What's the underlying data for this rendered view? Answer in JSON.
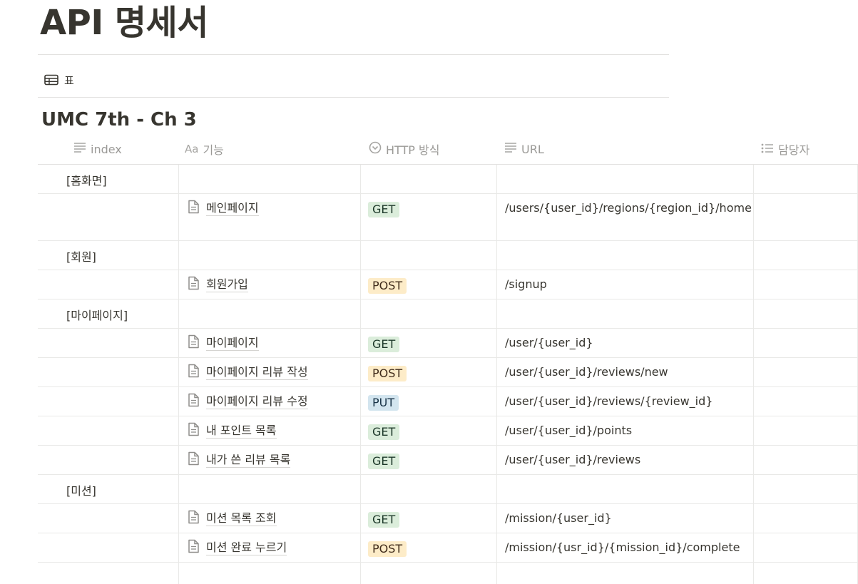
{
  "page": {
    "title": "API 명세서"
  },
  "view": {
    "label": "표",
    "icon": "table-icon"
  },
  "database": {
    "title": "UMC 7th - Ch 3"
  },
  "columns": {
    "index": "index",
    "feature": "기능",
    "method": "HTTP 방식",
    "url": "URL",
    "owner": "담당자"
  },
  "rows": [
    {
      "type": "group",
      "index": "[홈화면]"
    },
    {
      "type": "item",
      "feature": "메인페이지",
      "method": "GET",
      "url": "/users/{user_id}/regions/{region_id}/home"
    },
    {
      "type": "group",
      "index": "[회원]"
    },
    {
      "type": "item",
      "feature": "회원가입",
      "method": "POST",
      "url": "/signup"
    },
    {
      "type": "group",
      "index": "[마이페이지]"
    },
    {
      "type": "item",
      "feature": "마이페이지",
      "method": "GET",
      "url": "/user/{user_id}"
    },
    {
      "type": "item",
      "feature": "마이페이지 리뷰 작성",
      "method": "POST",
      "url": "/user/{user_id}/reviews/new"
    },
    {
      "type": "item",
      "feature": "마이페이지 리뷰 수정",
      "method": "PUT",
      "url": "/user/{user_id}/reviews/{review_id}"
    },
    {
      "type": "item",
      "feature": "내 포인트 목록",
      "method": "GET",
      "url": "/user/{user_id}/points"
    },
    {
      "type": "item",
      "feature": "내가 쓴 리뷰 목록",
      "method": "GET",
      "url": "/user/{user_id}/reviews"
    },
    {
      "type": "group",
      "index": "[미션]"
    },
    {
      "type": "item",
      "feature": "미션 목록 조회",
      "method": "GET",
      "url": "/mission/{user_id}"
    },
    {
      "type": "item",
      "feature": "미션 완료 누르기",
      "method": "POST",
      "url": "/mission/{usr_id}/{mission_id}/complete"
    }
  ],
  "colors": {
    "get_bg": "#dbeddb",
    "post_bg": "#fdecc8",
    "put_bg": "#d3e5ef"
  }
}
